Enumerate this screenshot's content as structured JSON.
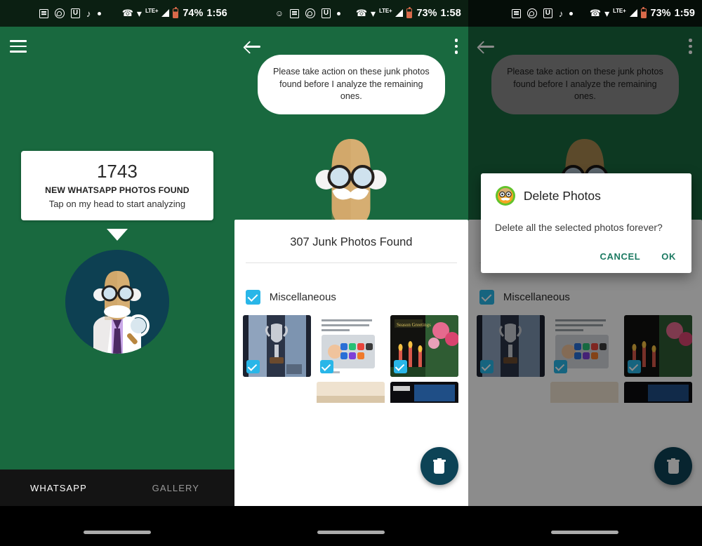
{
  "meta": {
    "green": "#19693F",
    "dark_green": "#0b1f12",
    "teal": "#1C7A62",
    "cyan": "#29B6E8",
    "fab": "#0d4356"
  },
  "panels": [
    {
      "id": "panel-1",
      "status": {
        "icons": [
          "news-icon",
          "whatsapp-icon",
          "u-app-icon",
          "tiktok-icon",
          "dot-icon"
        ],
        "right_icons": [
          "phone-call-icon",
          "wifi-icon",
          "signal-icon",
          "battery-icon"
        ],
        "network": "LTE+",
        "battery": "74%",
        "time": "1:56"
      },
      "appbar": {
        "menu": "hamburger-icon"
      },
      "card": {
        "count": "1743",
        "subtitle": "NEW WHATSAPP PHOTOS FOUND",
        "hint": "Tap on my head to start analyzing"
      },
      "tabs": [
        {
          "label": "WHATSAPP",
          "active": true
        },
        {
          "label": "GALLERY",
          "active": false
        }
      ]
    },
    {
      "id": "panel-2",
      "status": {
        "icons": [
          "mask-icon",
          "news-icon",
          "whatsapp-icon",
          "u-app-icon",
          "dot-icon"
        ],
        "right_icons": [
          "phone-call-icon",
          "wifi-icon",
          "signal-icon",
          "battery-icon"
        ],
        "network": "LTE+",
        "battery": "73%",
        "time": "1:58"
      },
      "appbar": {
        "back": "back-arrow-icon",
        "overflow": "kebab-menu-icon"
      },
      "bubble": "Please take action on these junk photos found before I analyze the remaining ones.",
      "sheet": {
        "title": "307 Junk Photos Found",
        "group_label": "Miscellaneous",
        "fab": "delete-trash-icon"
      }
    },
    {
      "id": "panel-3",
      "status": {
        "icons": [
          "news-icon",
          "whatsapp-icon",
          "u-app-icon",
          "tiktok-icon",
          "dot-icon"
        ],
        "right_icons": [
          "phone-call-icon",
          "wifi-icon",
          "signal-icon",
          "battery-icon"
        ],
        "network": "LTE+",
        "battery": "73%",
        "time": "1:59"
      },
      "appbar": {
        "back": "back-arrow-icon",
        "overflow": "kebab-menu-icon"
      },
      "bubble": "Please take action on these junk photos found before I analyze the remaining ones.",
      "sheet": {
        "title": "307 Junk Photos Found",
        "group_label": "Miscellaneous"
      },
      "dialog": {
        "icon": "professor-avatar-icon",
        "title": "Delete Photos",
        "message": "Delete all the selected photos forever?",
        "cancel": "CANCEL",
        "ok": "OK"
      }
    }
  ]
}
